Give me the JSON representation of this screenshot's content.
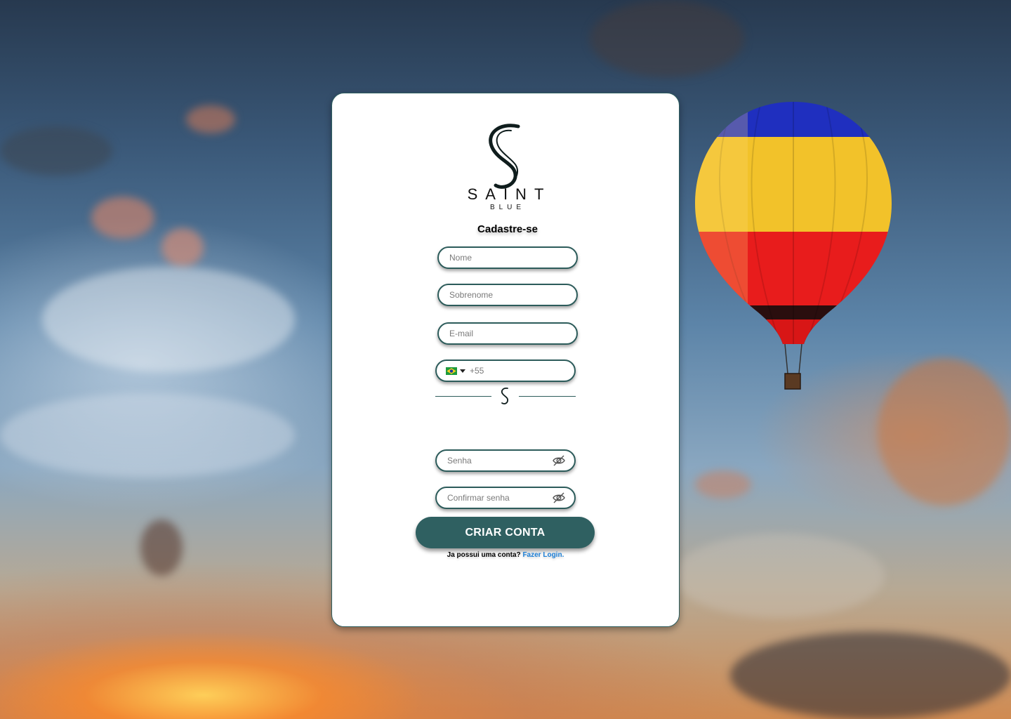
{
  "brand": {
    "name": "SAINT",
    "sub": "BLUE"
  },
  "form": {
    "title": "Cadastre-se",
    "first_name_placeholder": "Nome",
    "last_name_placeholder": "Sobrenome",
    "email_placeholder": "E-mail",
    "phone_code": "+55",
    "password_placeholder": "Senha",
    "confirm_password_placeholder": "Confirmar senha",
    "submit_label": "CRIAR CONTA",
    "login_prompt": "Ja possui uma conta?",
    "login_link": "Fazer Login."
  },
  "icons": {
    "country_flag": "brazil-flag-icon",
    "dropdown": "caret-down-icon",
    "password_toggle": "eye-off-icon"
  },
  "colors": {
    "accent": "#2f6061",
    "link": "#1d7fd6",
    "card": "#ffffff"
  }
}
